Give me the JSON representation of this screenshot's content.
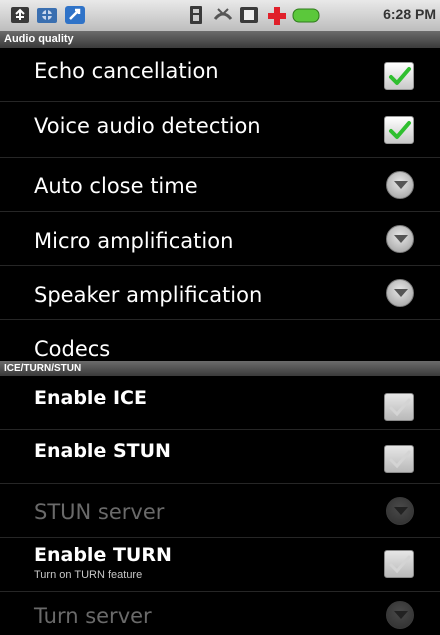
{
  "status_bar": {
    "time": "6:28 PM",
    "icons": [
      "usb-icon",
      "debug-icon",
      "sync-icon",
      "sim-icon",
      "missed-call-icon",
      "sd-card-icon",
      "medical-cross-icon",
      "battery-icon"
    ]
  },
  "sections": {
    "audio_quality": "Audio quality",
    "ice": "ICE/TURN/STUN"
  },
  "items": {
    "echo_cancellation": {
      "title": "Echo cancellation",
      "checked": true
    },
    "voice_audio_detection": {
      "title": "Voice audio detection",
      "checked": true
    },
    "auto_close_time": {
      "title": "Auto close time"
    },
    "micro_amplification": {
      "title": "Micro amplification"
    },
    "speaker_amplification": {
      "title": "Speaker amplification"
    },
    "codecs": {
      "title": "Codecs"
    },
    "enable_ice": {
      "title": "Enable ICE",
      "checked": false
    },
    "enable_stun": {
      "title": "Enable STUN",
      "checked": false
    },
    "stun_server": {
      "title": "STUN server",
      "enabled": false
    },
    "enable_turn": {
      "title": "Enable TURN",
      "summary": "Turn on TURN feature",
      "checked": false
    },
    "turn_server": {
      "title": "Turn server",
      "enabled": false
    }
  },
  "colors": {
    "check_green": "#2fbf2f",
    "header_gray": "#4f4f4f"
  }
}
